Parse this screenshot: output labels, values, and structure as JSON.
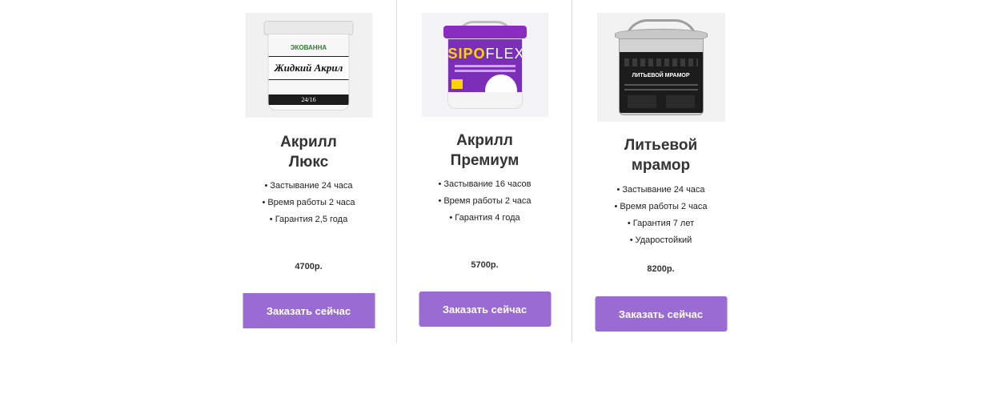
{
  "products": [
    {
      "title_line1": "Акрилл",
      "title_line2": "Люкс",
      "features": [
        "• Застывание 24 часа",
        "• Время работы 2 часа",
        "• Гарантия 2,5 года"
      ],
      "price": "4700р.",
      "button_label": "Заказать сейчас",
      "image": {
        "brand": "ЭКОВАННА",
        "label": "Жидкий Акрил",
        "code": "24/16",
        "icon": "white-bucket-icon"
      }
    },
    {
      "title_line1": "Акрилл",
      "title_line2": "Премиум",
      "features": [
        "• Застывание 16 часов",
        "• Время работы 2 часа",
        "• Гарантия 4 года"
      ],
      "price": "5700р.",
      "button_label": "Заказать сейчас",
      "image": {
        "brand_part1": "SIPO",
        "brand_part2": "FLEX",
        "icon": "purple-bucket-icon"
      }
    },
    {
      "title_line1": "Литьевой",
      "title_line2": "мрамор",
      "features": [
        "• Застывание 24 часа",
        "• Время работы 2 часа",
        "• Гарантия 7 лет",
        "• Ударостойкий"
      ],
      "price": "8200р.",
      "button_label": "Заказать сейчас",
      "image": {
        "label": "ЛИТЬЕВОЙ МРАМОР",
        "icon": "metal-bucket-icon"
      }
    }
  ],
  "colors": {
    "button": "#9a6bd2",
    "button_text": "#ffffff",
    "divider": "#dcdcdc"
  }
}
